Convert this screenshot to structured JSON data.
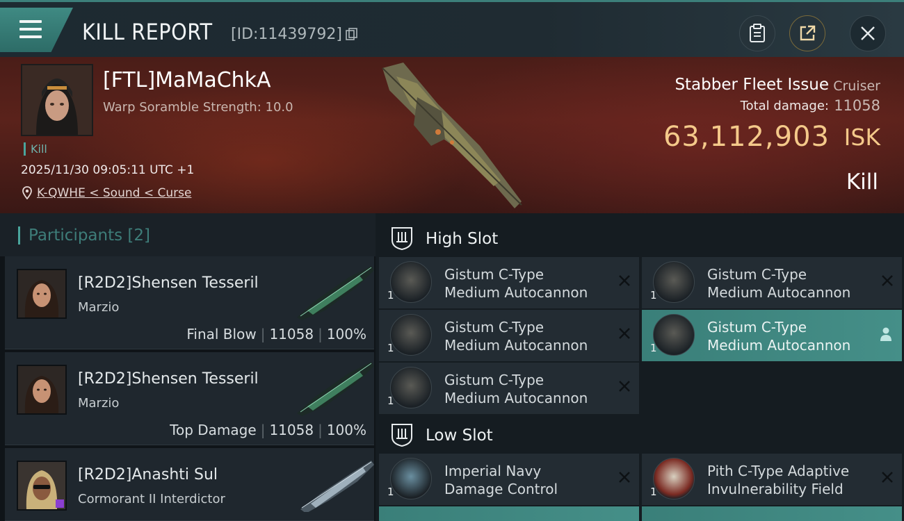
{
  "header": {
    "title": "KILL REPORT",
    "report_id": "[ID:11439792]",
    "icons": [
      "menu-icon",
      "copy-icon",
      "clipboard-icon",
      "share-icon",
      "close-icon"
    ]
  },
  "victim": {
    "name": "[FTL]MaMaChkA",
    "scramble": "Warp Soramble Strength: 10.0",
    "tag": "Kill",
    "datetime": "2025/11/30 09:05:11 UTC +1",
    "location": "K-QWHE < Sound < Curse",
    "ship_name": "Stabber Fleet Issue",
    "ship_class": "Cruiser",
    "total_damage_label": "Total damage:",
    "total_damage": "11058",
    "isk_value": "63,112,903",
    "isk_unit": "ISK",
    "result": "Kill"
  },
  "participants": {
    "label": "Participants [2]",
    "items": [
      {
        "name": "[R2D2]Shensen Tesseril",
        "ship": "Marzio",
        "role": "Final Blow",
        "damage": "11058",
        "percent": "100%"
      },
      {
        "name": "[R2D2]Shensen Tesseril",
        "ship": "Marzio",
        "role": "Top Damage",
        "damage": "11058",
        "percent": "100%"
      },
      {
        "name": "[R2D2]Anashti Sul",
        "ship": "Cormorant II Interdictor",
        "role": "",
        "damage": "",
        "percent": ""
      }
    ]
  },
  "high_slot": {
    "label": "High Slot",
    "modules": [
      {
        "line1": "Gistum C-Type",
        "line2": "Medium Autocannon",
        "qty": "1",
        "status": "destroyed"
      },
      {
        "line1": "Gistum C-Type",
        "line2": "Medium Autocannon",
        "qty": "1",
        "status": "destroyed"
      },
      {
        "line1": "Gistum C-Type",
        "line2": "Medium Autocannon",
        "qty": "1",
        "status": "destroyed"
      },
      {
        "line1": "Gistum C-Type",
        "line2": "Medium Autocannon",
        "qty": "1",
        "status": "dropped"
      },
      {
        "line1": "Gistum C-Type",
        "line2": "Medium Autocannon",
        "qty": "1",
        "status": "destroyed"
      }
    ]
  },
  "low_slot": {
    "label": "Low Slot",
    "modules": [
      {
        "line1": "Imperial Navy",
        "line2": "Damage Control",
        "qty": "1",
        "status": "destroyed"
      },
      {
        "line1": "Pith C-Type Adaptive",
        "line2": "Invulnerability Field",
        "qty": "1",
        "status": "destroyed"
      }
    ]
  },
  "colors": {
    "accent": "#3f8a83",
    "isk": "#f4c98a",
    "banner": "#5a221b"
  }
}
